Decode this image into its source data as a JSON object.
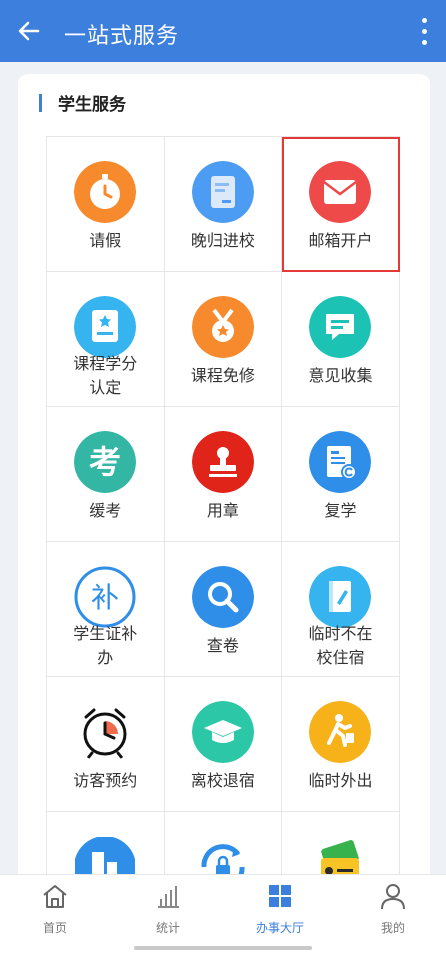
{
  "header": {
    "title": "一站式服务"
  },
  "section": {
    "title": "学生服务"
  },
  "services": [
    {
      "label": "请假",
      "icon": "clock-icon",
      "color": "#f68a2c"
    },
    {
      "label": "晚归进校",
      "icon": "document-icon",
      "color": "#4b9cf2"
    },
    {
      "label": "邮箱开户",
      "icon": "mail-icon",
      "color": "#ef4a4a"
    },
    {
      "label": "课程学分认定",
      "icon": "certificate-icon",
      "color": "#35b4f0"
    },
    {
      "label": "课程免修",
      "icon": "medal-icon",
      "color": "#f68a2c"
    },
    {
      "label": "意见收集",
      "icon": "chat-icon",
      "color": "#1cc3b4"
    },
    {
      "label": "缓考",
      "icon": "exam-icon",
      "color": "#33b6a4"
    },
    {
      "label": "用章",
      "icon": "stamp-icon",
      "color": "#e0241a"
    },
    {
      "label": "复学",
      "icon": "form-icon",
      "color": "#2f8fe8"
    },
    {
      "label": "学生证补办",
      "icon": "supplement-icon",
      "color": "#2f8fe8"
    },
    {
      "label": "查卷",
      "icon": "magnifier-icon",
      "color": "#2f8fe8"
    },
    {
      "label": "临时不在校住宿",
      "icon": "notebook-icon",
      "color": "#35b4f0"
    },
    {
      "label": "访客预约",
      "icon": "alarm-icon",
      "color": "#111111"
    },
    {
      "label": "离校退宿",
      "icon": "graduation-cap-icon",
      "color": "#2cc7a6"
    },
    {
      "label": "临时外出",
      "icon": "walking-person-icon",
      "color": "#f7b21a"
    },
    {
      "label": "",
      "icon": "building-icon",
      "color": "#2f8fe8"
    },
    {
      "label": "",
      "icon": "lock-refresh-icon",
      "color": "#2f8fe8"
    },
    {
      "label": "",
      "icon": "cards-icon",
      "color": "#37b24d"
    }
  ],
  "tabs": [
    {
      "label": "首页",
      "icon": "home-icon",
      "active": false
    },
    {
      "label": "统计",
      "icon": "bar-chart-icon",
      "active": false
    },
    {
      "label": "办事大厅",
      "icon": "grid-icon",
      "active": true
    },
    {
      "label": "我的",
      "icon": "person-icon",
      "active": false
    }
  ],
  "colors": {
    "primary": "#3c7fdc",
    "highlight": "#e53935"
  }
}
